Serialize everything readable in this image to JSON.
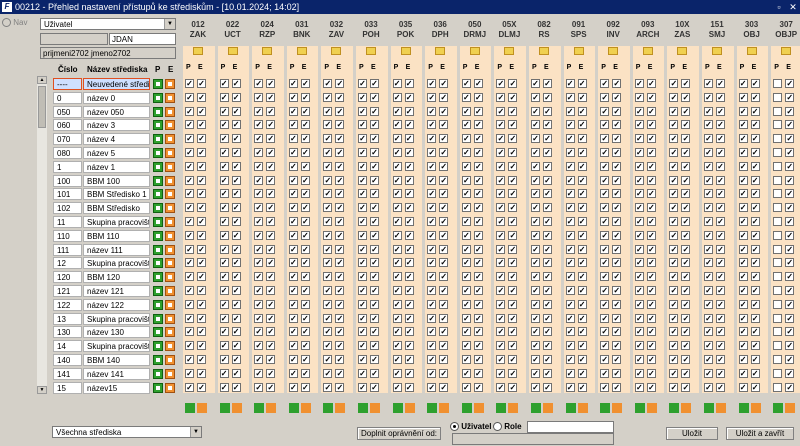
{
  "window": {
    "title": "00212 - Přehled nastavení přístupů ke střediskům - [10.01.2024; 14:02]",
    "restore_icon": "restore-icon",
    "close_icon": "close-icon"
  },
  "nav": {
    "label": "Nav"
  },
  "filter": {
    "subject_type": "Uživatel",
    "user_code": "JDAN",
    "user_name": "prijmeni2702 jmeno2702"
  },
  "table": {
    "col_number": "Číslo",
    "col_name": "Název střediska",
    "col_p": "P",
    "col_e": "E",
    "rows": [
      {
        "num": "----",
        "name": "Neuvedené středisko"
      },
      {
        "num": "0",
        "name": "název 0"
      },
      {
        "num": "050",
        "name": "název 050"
      },
      {
        "num": "060",
        "name": "název 3"
      },
      {
        "num": "070",
        "name": "název 4"
      },
      {
        "num": "080",
        "name": "název 5"
      },
      {
        "num": "1",
        "name": "název 1"
      },
      {
        "num": "100",
        "name": "BBM 100"
      },
      {
        "num": "101",
        "name": "BBM Středisko 1"
      },
      {
        "num": "102",
        "name": "BBM Středisko"
      },
      {
        "num": "11",
        "name": "Skupina pracovišť"
      },
      {
        "num": "110",
        "name": "BBM 110"
      },
      {
        "num": "111",
        "name": "název 111"
      },
      {
        "num": "12",
        "name": "Skupina pracovišť"
      },
      {
        "num": "120",
        "name": "BBM 120"
      },
      {
        "num": "121",
        "name": "název 121"
      },
      {
        "num": "122",
        "name": "název 122"
      },
      {
        "num": "13",
        "name": "Skupina pracovišť"
      },
      {
        "num": "130",
        "name": "název 130"
      },
      {
        "num": "14",
        "name": "Skupina pracovišť"
      },
      {
        "num": "140",
        "name": "BBM 140"
      },
      {
        "num": "141",
        "name": "název 141"
      },
      {
        "num": "15",
        "name": "název15"
      }
    ]
  },
  "modules": [
    {
      "code": "012",
      "abbr": "ZAK"
    },
    {
      "code": "022",
      "abbr": "UCT"
    },
    {
      "code": "024",
      "abbr": "RZP"
    },
    {
      "code": "031",
      "abbr": "BNK"
    },
    {
      "code": "032",
      "abbr": "ZAV"
    },
    {
      "code": "033",
      "abbr": "POH"
    },
    {
      "code": "035",
      "abbr": "POK"
    },
    {
      "code": "036",
      "abbr": "DPH"
    },
    {
      "code": "050",
      "abbr": "DRMJ"
    },
    {
      "code": "05X",
      "abbr": "DLMJ"
    },
    {
      "code": "082",
      "abbr": "RS"
    },
    {
      "code": "091",
      "abbr": "SPS"
    },
    {
      "code": "092",
      "abbr": "INV"
    },
    {
      "code": "093",
      "abbr": "ARCH"
    },
    {
      "code": "10X",
      "abbr": "ZAS"
    },
    {
      "code": "151",
      "abbr": "SMJ"
    },
    {
      "code": "303",
      "abbr": "OBJ"
    },
    {
      "code": "307",
      "abbr": "OBJP"
    }
  ],
  "colors": {
    "green": "#2ea02e",
    "orange": "#f09030",
    "title_bg": "#0a246a",
    "module_bg": "#fbe2c4"
  },
  "footer": {
    "scope_select": "Všechna střediska",
    "fill_button": "Doplnit oprávnění od:",
    "radio_user": "Uživatel",
    "radio_role": "Role",
    "save_button": "Uložit",
    "save_close_button": "Uložit a zavřít"
  }
}
